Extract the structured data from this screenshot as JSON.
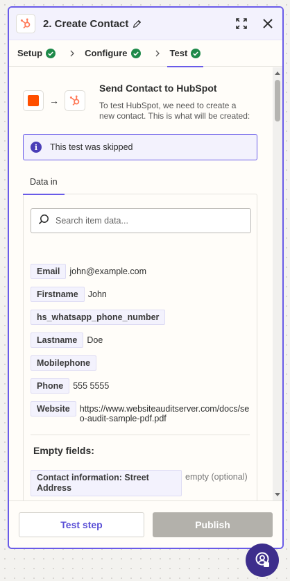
{
  "header": {
    "title": "2. Create Contact",
    "icons": {
      "app": "hubspot-icon",
      "edit": "pencil-icon",
      "expand": "expand-icon",
      "close": "close-icon"
    }
  },
  "tabs": [
    {
      "label": "Setup",
      "status": "complete"
    },
    {
      "label": "Configure",
      "status": "complete"
    },
    {
      "label": "Test",
      "status": "complete",
      "active": true
    }
  ],
  "step": {
    "title": "Send Contact to HubSpot",
    "description": "To test HubSpot, we need to create a new contact. This is what will be created:"
  },
  "alert": {
    "text": "This test was skipped",
    "icon": "info-icon"
  },
  "data_tabs": {
    "active": "Data in"
  },
  "search": {
    "placeholder": "Search item data..."
  },
  "fields": [
    {
      "key": "Email",
      "value": "john@example.com"
    },
    {
      "key": "Firstname",
      "value": "John"
    },
    {
      "key": "hs_whatsapp_phone_number",
      "value": ""
    },
    {
      "key": "Lastname",
      "value": "Doe"
    },
    {
      "key": "Mobilephone",
      "value": ""
    },
    {
      "key": "Phone",
      "value": "555 5555"
    },
    {
      "key": "Website",
      "value": "https://www.websiteauditserver.com/docs/seo-audit-sample-pdf.pdf"
    }
  ],
  "empty_fields": {
    "title": "Empty fields:",
    "items": [
      {
        "key": "Contact information: Street Address",
        "value": "empty (optional)"
      }
    ]
  },
  "footer": {
    "test_label": "Test step",
    "publish_label": "Publish"
  },
  "colors": {
    "accent": "#695be8",
    "success": "#1e8a4a",
    "hubspot": "#ff7a59",
    "zapier": "#ff4f00"
  }
}
